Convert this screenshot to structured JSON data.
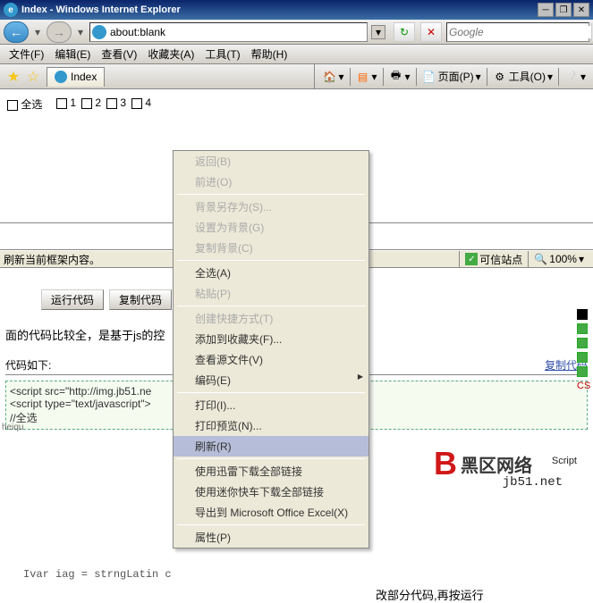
{
  "titlebar": {
    "title": "Index - Windows Internet Explorer"
  },
  "address": {
    "url": "about:blank"
  },
  "search": {
    "placeholder": "Google"
  },
  "menus": {
    "file": "文件(F)",
    "edit": "编辑(E)",
    "view": "查看(V)",
    "fav": "收藏夹(A)",
    "tools": "工具(T)",
    "help": "帮助(H)"
  },
  "tab": {
    "label": "Index"
  },
  "toolbar": {
    "page": "页面(P)",
    "tools": "工具(O)"
  },
  "content": {
    "select_all": "全选",
    "c1": "1",
    "c2": "2",
    "c3": "3",
    "c4": "4"
  },
  "status": {
    "text": "刷新当前框架内容。",
    "trusted": "可信站点",
    "zoom": "100%"
  },
  "btns": {
    "run": "运行代码",
    "copy": "复制代码"
  },
  "body_text": {
    "line1": "面的代码比较全，是基于js的控",
    "hint": "改部分代码,再按运行",
    "var": "Ivar iag = strngLatin  c"
  },
  "code_section": {
    "header": "代码如下:",
    "copy": "复制代码",
    "l1": "<script src=\"http://img.jb51.ne",
    "l2": "<script type=\"text/javascript\">",
    "l3": "//全选"
  },
  "context": {
    "back": "返回(B)",
    "forward": "前进(O)",
    "saveas": "背景另存为(S)...",
    "setbg": "设置为背景(G)",
    "copybg": "复制背景(C)",
    "selectall": "全选(A)",
    "paste": "粘贴(P)",
    "shortcut": "创建快捷方式(T)",
    "addfav": "添加到收藏夹(F)...",
    "viewsrc": "查看源文件(V)",
    "encoding": "编码(E)",
    "print": "打印(I)...",
    "printpre": "打印预览(N)...",
    "refresh": "刷新(R)",
    "xunlei": "使用迅雷下载全部链接",
    "kuaiche": "使用迷你快车下载全部链接",
    "excel": "导出到 Microsoft Office Excel(X)",
    "props": "属性(P)"
  },
  "watermark": {
    "brand": "黑区网络",
    "url": "jb51.net",
    "script": "Script",
    "hei": "heiqu",
    "cs": "CS"
  }
}
